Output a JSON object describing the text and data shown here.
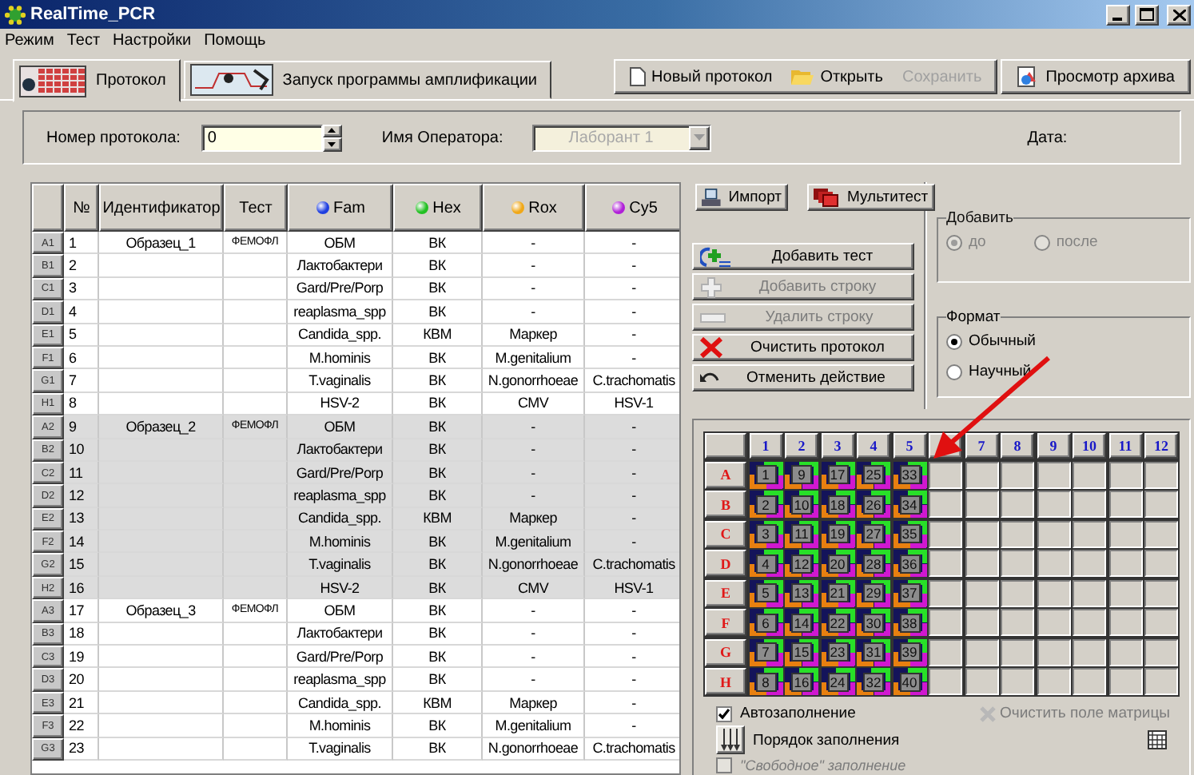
{
  "window": {
    "title": "RealTime_PCR"
  },
  "menu": [
    "Режим",
    "Тест",
    "Настройки",
    "Помощь"
  ],
  "tabs": [
    {
      "label": "Протокол",
      "selected": true,
      "kind": "table"
    },
    {
      "label": "Запуск программы амплификации",
      "selected": false,
      "kind": "chart"
    }
  ],
  "toolbar": [
    {
      "label": "Новый протокол",
      "kind": "new",
      "disabled": false
    },
    {
      "label": "Открыть",
      "kind": "open",
      "disabled": false
    },
    {
      "label": "Сохранить",
      "kind": "save",
      "disabled": true
    },
    {
      "label": "Просмотр архива",
      "kind": "archive",
      "disabled": false
    }
  ],
  "protocol": {
    "number_label": "Номер протокола:",
    "number_value": "0",
    "operator_label": "Имя Оператора:",
    "operator_value": "Лаборант 1",
    "operator_disabled": true,
    "date_label": "Дата:"
  },
  "table": {
    "columns": [
      {
        "label": "№"
      },
      {
        "label": "Идентификатор"
      },
      {
        "label": "Тест"
      },
      {
        "label": "Fam",
        "color": "#1f3fe0"
      },
      {
        "label": "Hex",
        "color": "#22c022"
      },
      {
        "label": "Rox",
        "color": "#f0a818"
      },
      {
        "label": "Cy5",
        "color": "#b020d8"
      }
    ],
    "rows": [
      {
        "well": "A1",
        "cells": [
          "1",
          "Образец_1",
          "ФЕМОФЛ",
          "ОБМ",
          "ВК",
          "-",
          "-"
        ],
        "selected": false
      },
      {
        "well": "B1",
        "cells": [
          "2",
          "",
          "",
          "Лактобактери",
          "ВК",
          "-",
          "-"
        ],
        "selected": false
      },
      {
        "well": "C1",
        "cells": [
          "3",
          "",
          "",
          "Gard/Pre/Porp",
          "ВК",
          "-",
          "-"
        ],
        "selected": false
      },
      {
        "well": "D1",
        "cells": [
          "4",
          "",
          "",
          "reaplasma_spp",
          "ВК",
          "-",
          "-"
        ],
        "selected": false
      },
      {
        "well": "E1",
        "cells": [
          "5",
          "",
          "",
          "Candida_spp.",
          "КВМ",
          "Маркер",
          "-"
        ],
        "selected": false
      },
      {
        "well": "F1",
        "cells": [
          "6",
          "",
          "",
          "M.hominis",
          "ВК",
          "M.genitalium",
          "-"
        ],
        "selected": false
      },
      {
        "well": "G1",
        "cells": [
          "7",
          "",
          "",
          "T.vaginalis",
          "ВК",
          "N.gonorrhoeae",
          "C.trachomatis"
        ],
        "selected": false
      },
      {
        "well": "H1",
        "cells": [
          "8",
          "",
          "",
          "HSV-2",
          "ВК",
          "CMV",
          "HSV-1"
        ],
        "selected": false
      },
      {
        "well": "A2",
        "cells": [
          "9",
          "Образец_2",
          "ФЕМОФЛ",
          "ОБМ",
          "ВК",
          "-",
          "-"
        ],
        "selected": true
      },
      {
        "well": "B2",
        "cells": [
          "10",
          "",
          "",
          "Лактобактери",
          "ВК",
          "-",
          "-"
        ],
        "selected": true
      },
      {
        "well": "C2",
        "cells": [
          "11",
          "",
          "",
          "Gard/Pre/Porp",
          "ВК",
          "-",
          "-"
        ],
        "selected": true
      },
      {
        "well": "D2",
        "cells": [
          "12",
          "",
          "",
          "reaplasma_spp",
          "ВК",
          "-",
          "-"
        ],
        "selected": true
      },
      {
        "well": "E2",
        "cells": [
          "13",
          "",
          "",
          "Candida_spp.",
          "КВМ",
          "Маркер",
          "-"
        ],
        "selected": true
      },
      {
        "well": "F2",
        "cells": [
          "14",
          "",
          "",
          "M.hominis",
          "ВК",
          "M.genitalium",
          "-"
        ],
        "selected": true
      },
      {
        "well": "G2",
        "cells": [
          "15",
          "",
          "",
          "T.vaginalis",
          "ВК",
          "N.gonorrhoeae",
          "C.trachomatis"
        ],
        "selected": true
      },
      {
        "well": "H2",
        "cells": [
          "16",
          "",
          "",
          "HSV-2",
          "ВК",
          "CMV",
          "HSV-1"
        ],
        "selected": true
      },
      {
        "well": "A3",
        "cells": [
          "17",
          "Образец_3",
          "ФЕМОФЛ",
          "ОБМ",
          "ВК",
          "-",
          "-"
        ],
        "selected": false
      },
      {
        "well": "B3",
        "cells": [
          "18",
          "",
          "",
          "Лактобактери",
          "ВК",
          "-",
          "-"
        ],
        "selected": false
      },
      {
        "well": "C3",
        "cells": [
          "19",
          "",
          "",
          "Gard/Pre/Porp",
          "ВК",
          "-",
          "-"
        ],
        "selected": false
      },
      {
        "well": "D3",
        "cells": [
          "20",
          "",
          "",
          "reaplasma_spp",
          "ВК",
          "-",
          "-"
        ],
        "selected": false
      },
      {
        "well": "E3",
        "cells": [
          "21",
          "",
          "",
          "Candida_spp.",
          "КВМ",
          "Маркер",
          "-"
        ],
        "selected": false
      },
      {
        "well": "F3",
        "cells": [
          "22",
          "",
          "",
          "M.hominis",
          "ВК",
          "M.genitalium",
          "-"
        ],
        "selected": false
      },
      {
        "well": "G3",
        "cells": [
          "23",
          "",
          "",
          "T.vaginalis",
          "ВК",
          "N.gonorrhoeae",
          "C.trachomatis"
        ],
        "selected": false
      }
    ]
  },
  "top_buttons": [
    {
      "label": "Импорт",
      "kind": "import"
    },
    {
      "label": "Мультитест",
      "kind": "multitest"
    }
  ],
  "actions": [
    {
      "label": "Добавить тест",
      "kind": "add-test",
      "disabled": false
    },
    {
      "label": "Добавить строку",
      "kind": "add-row",
      "disabled": true
    },
    {
      "label": "Удалить строку",
      "kind": "remove-row",
      "disabled": true
    },
    {
      "label": "Очистить протокол",
      "kind": "clear",
      "disabled": false
    },
    {
      "label": "Отменить действие",
      "kind": "undo",
      "disabled": false
    }
  ],
  "add_group": {
    "title": "Добавить",
    "disabled": true,
    "options": [
      {
        "label": "до",
        "selected": true
      },
      {
        "label": "после",
        "selected": false
      }
    ]
  },
  "format_group": {
    "title": "Формат",
    "disabled": false,
    "options": [
      {
        "label": "Обычный",
        "selected": true
      },
      {
        "label": "Научный",
        "selected": false
      }
    ]
  },
  "plate": {
    "columns": [
      {
        "label": "1"
      },
      {
        "label": "2"
      },
      {
        "label": "3"
      },
      {
        "label": "4"
      },
      {
        "label": "5"
      },
      {},
      {
        "label": "7"
      },
      {
        "label": "8"
      },
      {
        "label": "9"
      },
      {
        "label": "10"
      },
      {
        "label": "11"
      },
      {
        "label": "12"
      }
    ],
    "rows": [
      {
        "label": "A",
        "wells": [
          "1",
          "9",
          "17",
          "25",
          "33"
        ]
      },
      {
        "label": "B",
        "wells": [
          "2",
          "10",
          "18",
          "26",
          "34"
        ]
      },
      {
        "label": "C",
        "wells": [
          "3",
          "11",
          "19",
          "27",
          "35"
        ]
      },
      {
        "label": "D",
        "wells": [
          "4",
          "12",
          "20",
          "28",
          "36"
        ]
      },
      {
        "label": "E",
        "wells": [
          "5",
          "13",
          "21",
          "29",
          "37"
        ]
      },
      {
        "label": "F",
        "wells": [
          "6",
          "14",
          "22",
          "30",
          "38"
        ]
      },
      {
        "label": "G",
        "wells": [
          "7",
          "15",
          "23",
          "31",
          "39"
        ]
      },
      {
        "label": "H",
        "wells": [
          "8",
          "16",
          "24",
          "32",
          "40"
        ]
      }
    ]
  },
  "autofill": {
    "label": "Автозаполнение",
    "checked": true
  },
  "clear_matrix": {
    "label": "Очистить поле матрицы",
    "disabled": true
  },
  "fill_order": {
    "label": "Порядок заполнения"
  },
  "free_fill": {
    "label": "\"Свободное\" заполнение",
    "checked": false,
    "disabled": true
  }
}
